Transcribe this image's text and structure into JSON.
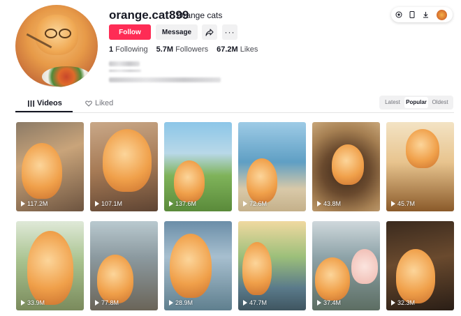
{
  "profile": {
    "username": "orange.cat899",
    "nickname": "Orange cats",
    "follow_label": "Follow",
    "message_label": "Message",
    "more_label": "···",
    "stats": [
      {
        "num": "1",
        "label": "Following"
      },
      {
        "num": "5.7M",
        "label": "Followers"
      },
      {
        "num": "67.2M",
        "label": "Likes"
      }
    ]
  },
  "tabs": {
    "videos": "Videos",
    "liked": "Liked"
  },
  "sort": {
    "options": [
      "Latest",
      "Popular",
      "Oldest"
    ],
    "selected": "Popular"
  },
  "videos": [
    {
      "views": "117.2M"
    },
    {
      "views": "107.1M"
    },
    {
      "views": "137.6M"
    },
    {
      "views": "72.6M"
    },
    {
      "views": "43.8M"
    },
    {
      "views": "45.7M"
    },
    {
      "views": "33.9M"
    },
    {
      "views": "77.8M"
    },
    {
      "views": "28.9M"
    },
    {
      "views": "47.7M"
    },
    {
      "views": "37.4M"
    },
    {
      "views": "32.3M"
    }
  ],
  "colors": {
    "accent": "#fe2c55",
    "text": "#161823",
    "muted": "#73747b"
  },
  "icons": [
    "share-icon",
    "grid-icon",
    "heart-outline-icon",
    "play-icon",
    "coin-icon",
    "phone-icon",
    "download-icon"
  ]
}
